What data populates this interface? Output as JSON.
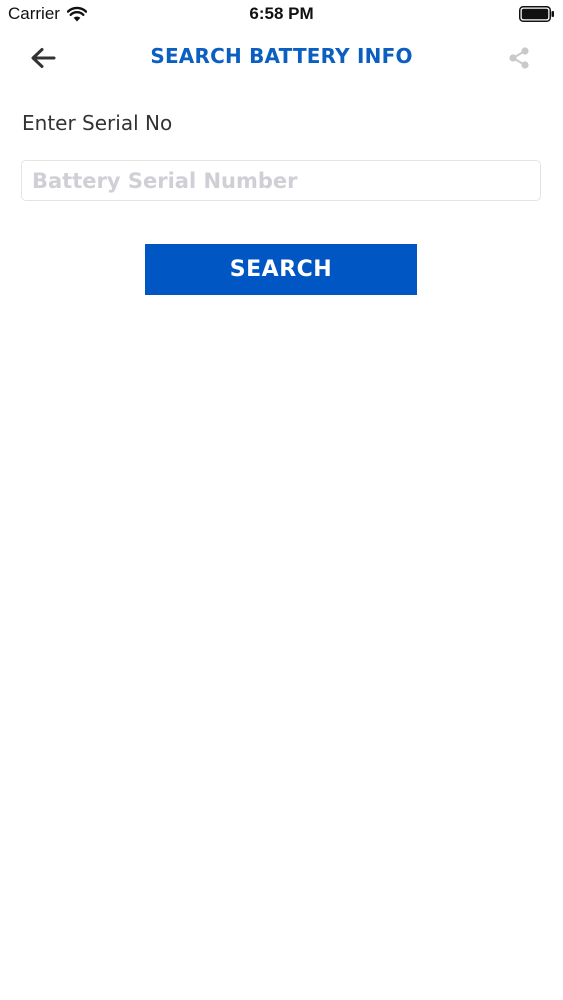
{
  "status_bar": {
    "carrier": "Carrier",
    "time": "6:58 PM",
    "wifi_icon": "wifi-icon",
    "battery_icon": "battery-full-icon"
  },
  "nav": {
    "title": "SEARCH BATTERY INFO",
    "back_icon": "arrow-left-icon",
    "share_icon": "share-icon"
  },
  "form": {
    "label": "Enter Serial No",
    "serial_input": {
      "value": "",
      "placeholder": "Battery Serial Number"
    },
    "search_button_label": "SEARCH"
  },
  "colors": {
    "accent": "#0b5fc0",
    "button": "#0057c3",
    "placeholder": "#cfcfd6",
    "share_icon": "#c9c9c9"
  }
}
